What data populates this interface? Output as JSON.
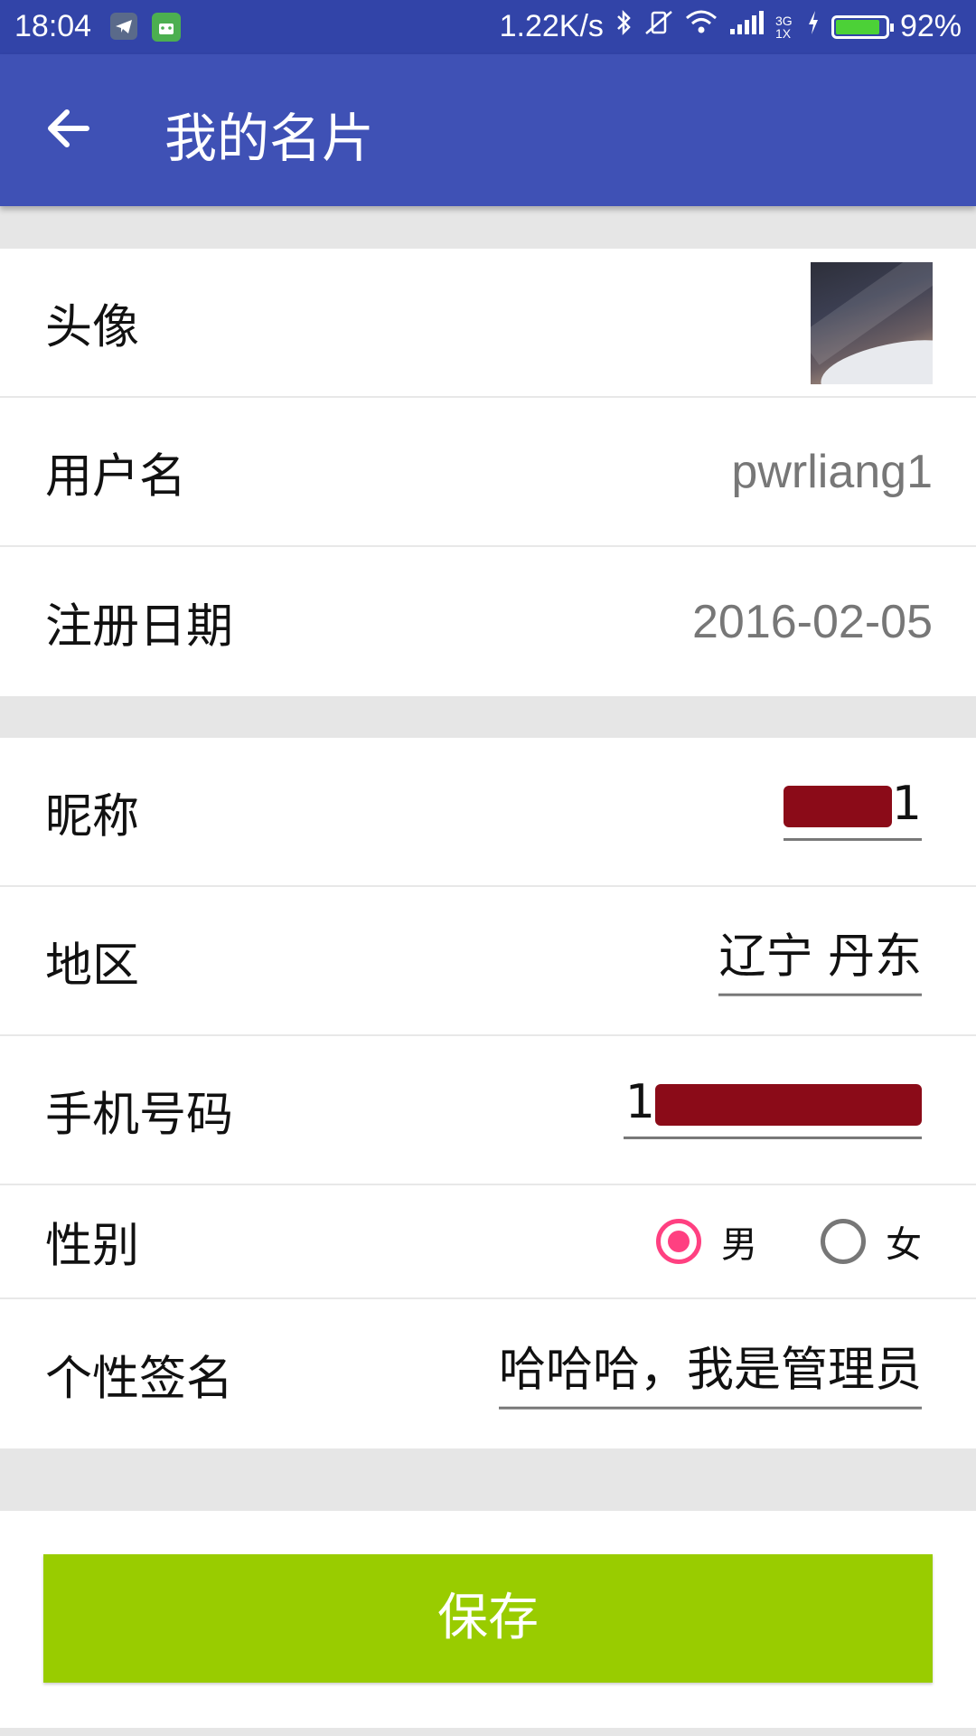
{
  "status_bar": {
    "time": "18:04",
    "network_speed": "1.22K/s",
    "signal_type": "3G 1X",
    "battery_percent": "92%",
    "battery_level": 0.92
  },
  "appbar": {
    "title": "我的名片"
  },
  "profile": {
    "avatar_label": "头像",
    "username_label": "用户名",
    "username_value": "pwrliang1",
    "register_date_label": "注册日期",
    "register_date_value": "2016-02-05"
  },
  "editable": {
    "nickname_label": "昵称",
    "nickname_value": "1",
    "region_label": "地区",
    "region_value": "辽宁 丹东",
    "phone_label": "手机号码",
    "phone_value": "1",
    "gender_label": "性别",
    "gender_male": "男",
    "gender_female": "女",
    "gender_selected": "男",
    "signature_label": "个性签名",
    "signature_value": "哈哈哈，我是管理员"
  },
  "actions": {
    "save_label": "保存"
  },
  "colors": {
    "appbar": "#3f51b5",
    "status_bar": "#3244a8",
    "save_button": "#99cc00",
    "radio_accent": "#ff4081"
  }
}
